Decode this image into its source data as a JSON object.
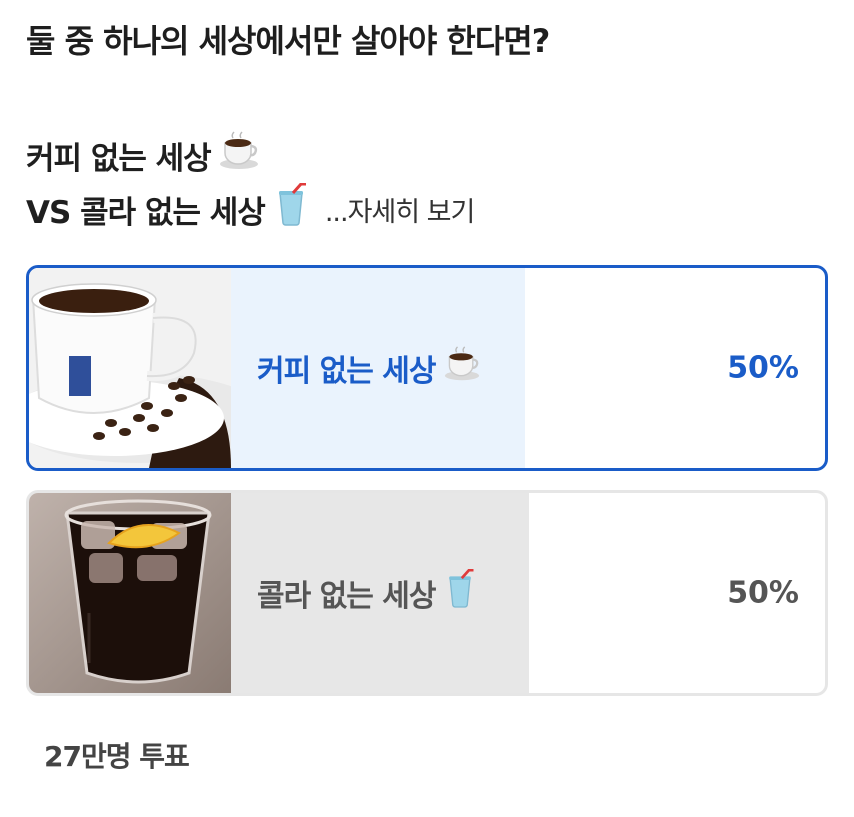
{
  "poll": {
    "question": "둘 중 하나의 세상에서만 살아야 한다면?",
    "description": {
      "line1": "커피 없는 세상",
      "line2": "VS 콜라 없는 세상",
      "more_link": "...자세히 보기"
    },
    "options": [
      {
        "label": "커피 없는 세상",
        "percent": "50%",
        "percent_value": 0.5,
        "selected": true,
        "emoji_icon": "coffee-cup-icon",
        "image": "coffee-cup-with-beans-photo"
      },
      {
        "label": "콜라 없는 세상",
        "percent": "50%",
        "percent_value": 0.5,
        "selected": false,
        "emoji_icon": "cola-cup-with-straw-icon",
        "image": "cola-glass-with-ice-and-lemon-photo"
      }
    ],
    "vote_count": "27만명 투표"
  },
  "colors": {
    "accent": "#1a5cc8",
    "selected_fill": "#eaf3fd",
    "unselected_fill": "#e7e7e7",
    "unselected_border": "#e6e6e6",
    "unselected_text": "#555555"
  }
}
